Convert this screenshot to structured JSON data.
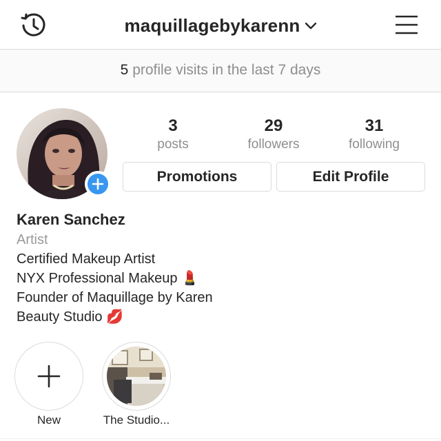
{
  "header": {
    "username": "maquillagebykarenn",
    "history_icon": "history-clock-icon",
    "dropdown_icon": "chevron-down-icon",
    "menu_icon": "hamburger-menu-icon"
  },
  "insights": {
    "count": "5",
    "text": " profile visits in the last 7 days"
  },
  "profile": {
    "avatar_icon": "profile-photo",
    "add_story_icon": "plus-icon",
    "stats": [
      {
        "value": "3",
        "label": "posts"
      },
      {
        "value": "29",
        "label": "followers"
      },
      {
        "value": "31",
        "label": "following"
      }
    ],
    "buttons": {
      "promotions": "Promotions",
      "edit_profile": "Edit Profile"
    }
  },
  "bio": {
    "name": "Karen Sanchez",
    "category": "Artist",
    "lines": [
      "Certified Makeup Artist",
      "NYX Professional Makeup 💄",
      "Founder of Maquillage by Karen",
      "Beauty Studio 💋"
    ]
  },
  "highlights": [
    {
      "label": "New",
      "icon": "plus-icon"
    },
    {
      "label": "The Studio...",
      "icon": "studio-photo"
    }
  ],
  "colors": {
    "accent": "#3897f0",
    "text": "#262626",
    "muted": "#8e8e8e",
    "border": "#dbdbdb"
  }
}
